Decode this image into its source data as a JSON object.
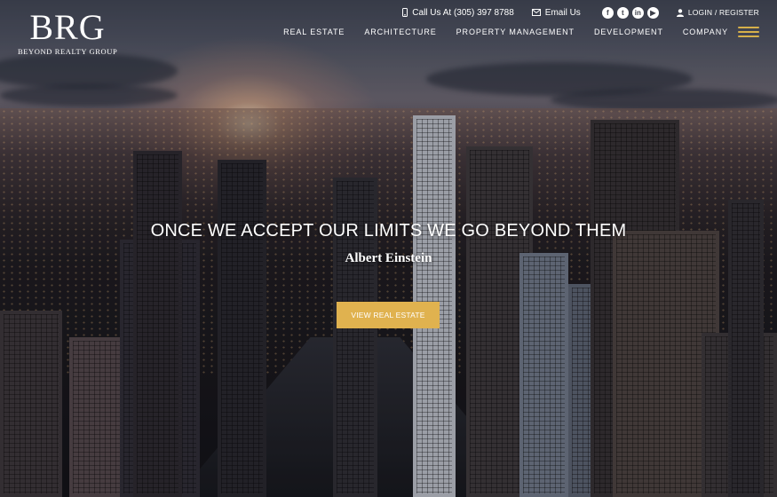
{
  "brand": {
    "mark": "BRG",
    "subtitle": "BEYOND REALTY GROUP"
  },
  "topbar": {
    "phone_label": "Call Us At (305) 397 8788",
    "email_label": "Email Us",
    "social": [
      {
        "name": "facebook-icon",
        "glyph": "f"
      },
      {
        "name": "twitter-icon",
        "glyph": "t"
      },
      {
        "name": "linkedin-icon",
        "glyph": "in"
      },
      {
        "name": "youtube-icon",
        "glyph": "▶"
      }
    ],
    "login_label": "LOGIN / REGISTER"
  },
  "nav": {
    "items": [
      {
        "label": "REAL ESTATE"
      },
      {
        "label": "ARCHITECTURE"
      },
      {
        "label": "PROPERTY MANAGEMENT"
      },
      {
        "label": "DEVELOPMENT"
      },
      {
        "label": "COMPANY"
      }
    ]
  },
  "hero": {
    "quote": "ONCE WE ACCEPT OUR LIMITS WE GO BEYOND THEM",
    "author": "Albert Einstein",
    "cta_label": "VIEW REAL ESTATE"
  },
  "colors": {
    "accent": "#e0b24f",
    "text": "#ffffff"
  }
}
